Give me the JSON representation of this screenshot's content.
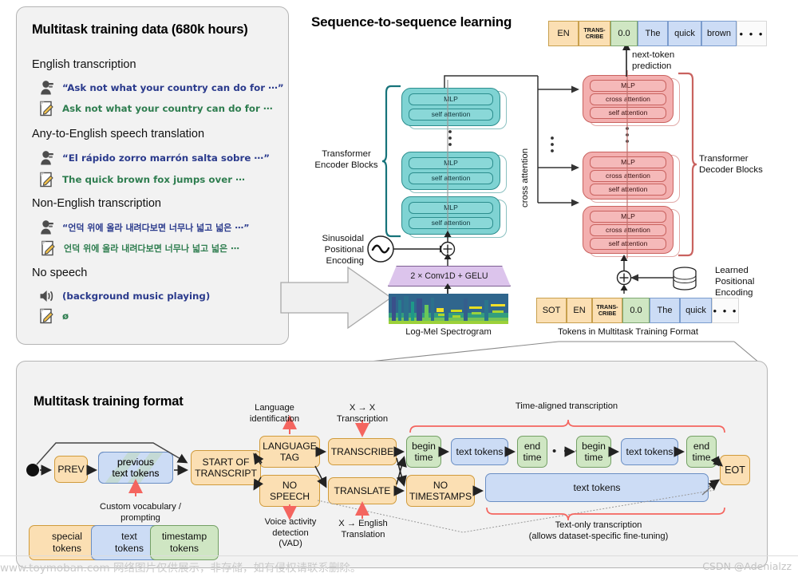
{
  "figure": {
    "title_left": "Multitask training data (680k hours)",
    "title_center": "Sequence-to-sequence learning",
    "title_bottom": "Multitask training format"
  },
  "training_data": {
    "sections": [
      {
        "heading": "English transcription",
        "audio_icon": "microphone-icon",
        "audio": "“Ask not what your country can do for ⋯”",
        "text_icon": "note-edit-icon",
        "text": "Ask not what your country can do for ⋯"
      },
      {
        "heading": "Any-to-English speech translation",
        "audio_icon": "microphone-icon",
        "audio": "“El rápido zorro marrón salta sobre ⋯”",
        "text_icon": "note-edit-icon",
        "text": "The quick brown fox jumps over ⋯"
      },
      {
        "heading": "Non-English transcription",
        "audio_icon": "microphone-icon",
        "audio": "“언덕 위에 올라 내려다보면 너무나 넓고 넓은 ⋯”",
        "text_icon": "note-edit-icon",
        "text": "언덕 위에 올라 내려다보면 너무나 넓고 넓은 ⋯"
      },
      {
        "heading": "No speech",
        "audio_icon": "speaker-icon",
        "audio": "(background music playing)",
        "text_icon": "note-edit-icon",
        "text": "ø"
      }
    ]
  },
  "seq2seq": {
    "output_tokens": [
      {
        "label": "EN",
        "kind": "special"
      },
      {
        "label": "TRANS-\nCRIBE",
        "kind": "special"
      },
      {
        "label": "0.0",
        "kind": "timestamp"
      },
      {
        "label": "The",
        "kind": "text"
      },
      {
        "label": "quick",
        "kind": "text"
      },
      {
        "label": "brown",
        "kind": "text"
      },
      {
        "label": "• • •",
        "kind": "dots"
      }
    ],
    "input_tokens": [
      {
        "label": "SOT",
        "kind": "special"
      },
      {
        "label": "EN",
        "kind": "special"
      },
      {
        "label": "TRANS-\nCRIBE",
        "kind": "special"
      },
      {
        "label": "0.0",
        "kind": "timestamp"
      },
      {
        "label": "The",
        "kind": "text"
      },
      {
        "label": "quick",
        "kind": "text"
      },
      {
        "label": "• • •",
        "kind": "dots"
      }
    ],
    "next_token_prediction": "next-token\nprediction",
    "encoder_label": "Transformer\nEncoder Blocks",
    "decoder_label": "Transformer\nDecoder Blocks",
    "cross_attention_label": "cross attention",
    "sinusoidal_label": "Sinusoidal\nPositional\nEncoding",
    "learned_label": "Learned\nPositional\nEncoding",
    "conv_label": "2 × Conv1D + GELU",
    "spectrogram_caption": "Log-Mel Spectrogram",
    "tokens_caption": "Tokens in Multitask Training Format",
    "block_layers": {
      "mlp": "MLP",
      "self_attention": "self attention",
      "cross_attention": "cross attention"
    }
  },
  "format": {
    "nodes": {
      "prev": "PREV",
      "previous_text_tokens": "previous\ntext tokens",
      "start_of_transcript": "START OF\nTRANSCRIPT",
      "language_tag": "LANGUAGE\nTAG",
      "no_speech": "NO\nSPEECH",
      "transcribe": "TRANSCRIBE",
      "translate": "TRANSLATE",
      "begin_time_1": "begin\ntime",
      "text_tokens_1": "text tokens",
      "end_time_1": "end\ntime",
      "begin_time_2": "begin\ntime",
      "text_tokens_2": "text tokens",
      "end_time_2": "end\ntime",
      "no_timestamps": "NO\nTIMESTAMPS",
      "text_tokens_long": "text tokens",
      "eot": "EOT",
      "ellipsis": "• • •"
    },
    "annotations": {
      "language_identification": "Language\nidentification",
      "x_to_x": "X → X\nTranscription",
      "time_aligned": "Time-aligned transcription",
      "custom_vocabulary": "Custom vocabulary /\nprompting",
      "vad": "Voice activity\ndetection\n(VAD)",
      "x_to_english": "X → English\nTranslation",
      "text_only": "Text-only transcription\n(allows dataset-specific fine-tuning)"
    },
    "legend": [
      {
        "label": "special\ntokens",
        "kind": "special"
      },
      {
        "label": "text\ntokens",
        "kind": "text"
      },
      {
        "label": "timestamp\ntokens",
        "kind": "timestamp"
      }
    ]
  },
  "watermark": {
    "left": "www.toymoban.com 网络图片仅供展示，非存储，如有侵权请联系删除。",
    "right": "CSDN @Adenialzz"
  },
  "colors": {
    "special_token": "#fbdfb3",
    "text_token": "#ccdcf5",
    "timestamp_token": "#cfe6c3",
    "encoder": "#7fd3d3",
    "decoder": "#f3afaf",
    "conv": "#dcc4ec",
    "accent_red": "#f4655f"
  }
}
